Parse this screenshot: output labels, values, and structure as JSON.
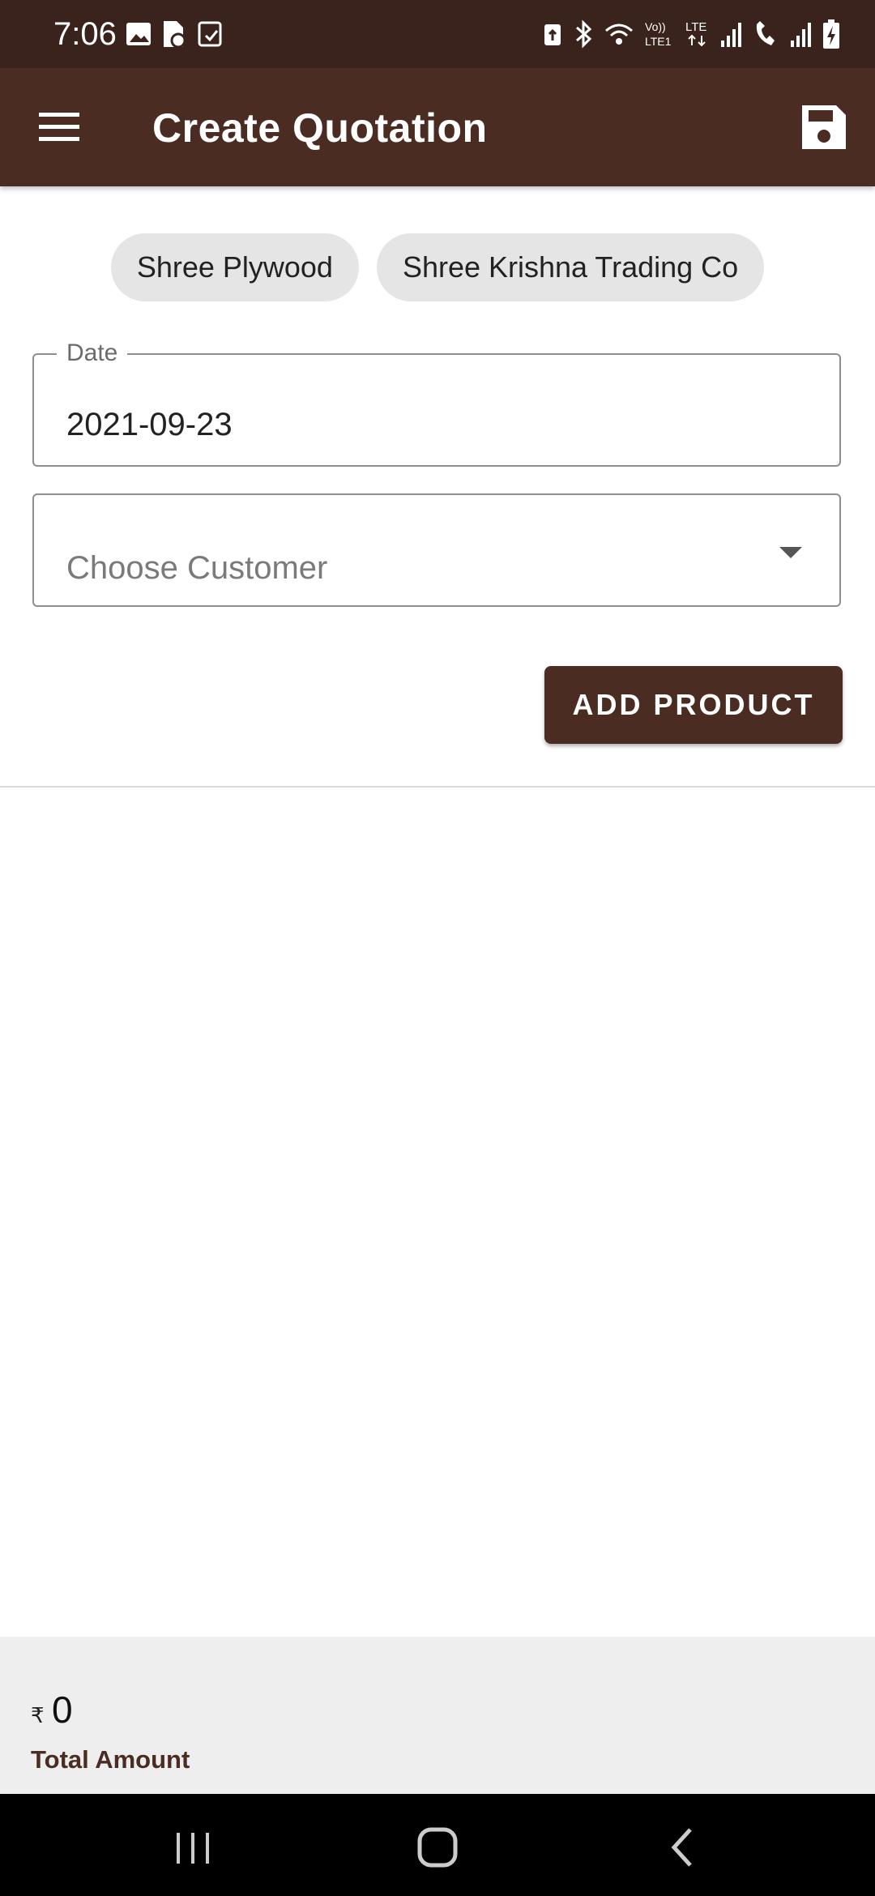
{
  "status_bar": {
    "time": "7:06",
    "left_icons": [
      "gallery-icon",
      "file-sync-icon",
      "task-check-icon"
    ],
    "right_icons": [
      "recycle-icon",
      "bluetooth-icon",
      "wifi-icon",
      "volte-lte1-icon",
      "lte-data-icon",
      "signal-sim1-icon",
      "wifi-call-icon",
      "signal-sim2-icon",
      "battery-charging-icon"
    ]
  },
  "app_bar": {
    "title": "Create Quotation",
    "menu_icon": "hamburger-menu-icon",
    "save_icon": "save-floppy-icon"
  },
  "companies": [
    {
      "label": "Shree Plywood"
    },
    {
      "label": "Shree Krishna Trading Co"
    }
  ],
  "form": {
    "date_label": "Date",
    "date_value": "2021-09-23",
    "customer_placeholder": "Choose Customer"
  },
  "actions": {
    "add_product_label": "ADD PRODUCT"
  },
  "footer": {
    "currency_symbol": "₹",
    "total_value": "0",
    "total_label": "Total Amount"
  },
  "colors": {
    "status_bar": "#3a231c",
    "app_bar": "#4b2c23",
    "accent_button": "#4b2c23",
    "chip_bg": "#e5e5e5",
    "footer_bg": "#eeeeee"
  },
  "nav_bar": {
    "buttons": [
      "recent-apps-icon",
      "home-icon",
      "back-icon"
    ]
  }
}
